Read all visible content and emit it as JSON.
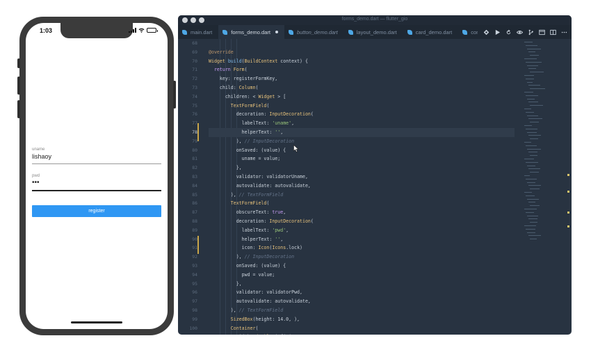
{
  "phone": {
    "time": "1:03",
    "fields": [
      {
        "label": "uname",
        "value": "lishaoy"
      },
      {
        "label": "pwd",
        "value": "•••"
      }
    ],
    "register_label": "register"
  },
  "editor": {
    "window_title": "forms_demo.dart — flutter_gio",
    "tabs": [
      {
        "label": "main.dart",
        "active": false
      },
      {
        "label": "forms_demo.dart",
        "active": true,
        "modified": true
      },
      {
        "label": "button_demo.dart",
        "active": false
      },
      {
        "label": "layout_demo.dart",
        "active": false
      },
      {
        "label": "card_demo.dart",
        "active": false
      },
      {
        "label": "con",
        "active": false
      }
    ],
    "actions": [
      "flutter-icon",
      "run-icon",
      "refresh-icon",
      "eye-icon",
      "git-icon",
      "preview-icon",
      "split-editor-icon",
      "more-icon"
    ],
    "line_numbers": [
      "68",
      "69",
      "70",
      "71",
      "72",
      "73",
      "74",
      "75",
      "76",
      "77",
      "78",
      "79",
      "80",
      "81",
      "82",
      "83",
      "84",
      "85",
      "86",
      "87",
      "88",
      "89",
      "90",
      "91",
      "92",
      "93",
      "94",
      "95",
      "96",
      "97",
      "98",
      "99",
      "100",
      "101"
    ],
    "current_line": "78",
    "lines": [
      "",
      "@override",
      "Widget build(BuildContext context) {",
      "  return Form(",
      "    key: registerFormKey,",
      "    child: Column(",
      "      children: < Widget > [",
      "        TextFormField(",
      "          decoration: InputDecoration(",
      "            labelText: 'uname',",
      "            helperText: '',",
      "          ), // InputDecoration",
      "          onSaved: (value) {",
      "            uname = value;",
      "          },",
      "          validator: validatorUname,",
      "          autovalidate: autovalidate,",
      "        ), // TextFormField",
      "        TextFormField(",
      "          obscureText: true,",
      "          decoration: InputDecoration(",
      "            labelText: 'pwd',",
      "            helperText: '',",
      "            icon: Icon(Icons.lock)",
      "          ), // InputDecoration",
      "          onSaved: (value) {",
      "            pwd = value;",
      "          },",
      "          validator: validatorPwd,",
      "          autovalidate: autovalidate,",
      "        ), // TextFormField",
      "        SizedBox(height: 14.0, ),",
      "        Container(",
      "          width: double.infinity,"
    ],
    "colors": {
      "background": "#283341",
      "tab_bar": "#1f2833",
      "keyword": "#c59bf2",
      "type": "#e5c07b",
      "string": "#98c379",
      "comment": "#65748a",
      "button": "#2f97f3"
    }
  }
}
